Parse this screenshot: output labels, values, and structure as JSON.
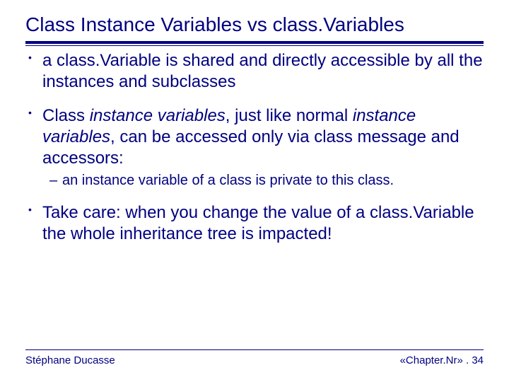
{
  "title": "Class Instance Variables vs class.Variables",
  "bullets": [
    {
      "text": "a class.Variable is shared and directly accessible by all the instances and subclasses"
    },
    {
      "prefix": "Class ",
      "italic1": "instance variables",
      "mid": ", just like normal ",
      "italic2": "instance variables",
      "suffix": ", can be accessed only via class message and accessors:",
      "sub": [
        "an instance variable of a class is private to this class."
      ]
    },
    {
      "text": "Take care: when you change the value of a class.Variable the whole inheritance tree is impacted!"
    }
  ],
  "footer": {
    "left": "Stéphane Ducasse",
    "right": "«Chapter.Nr» . 34"
  }
}
